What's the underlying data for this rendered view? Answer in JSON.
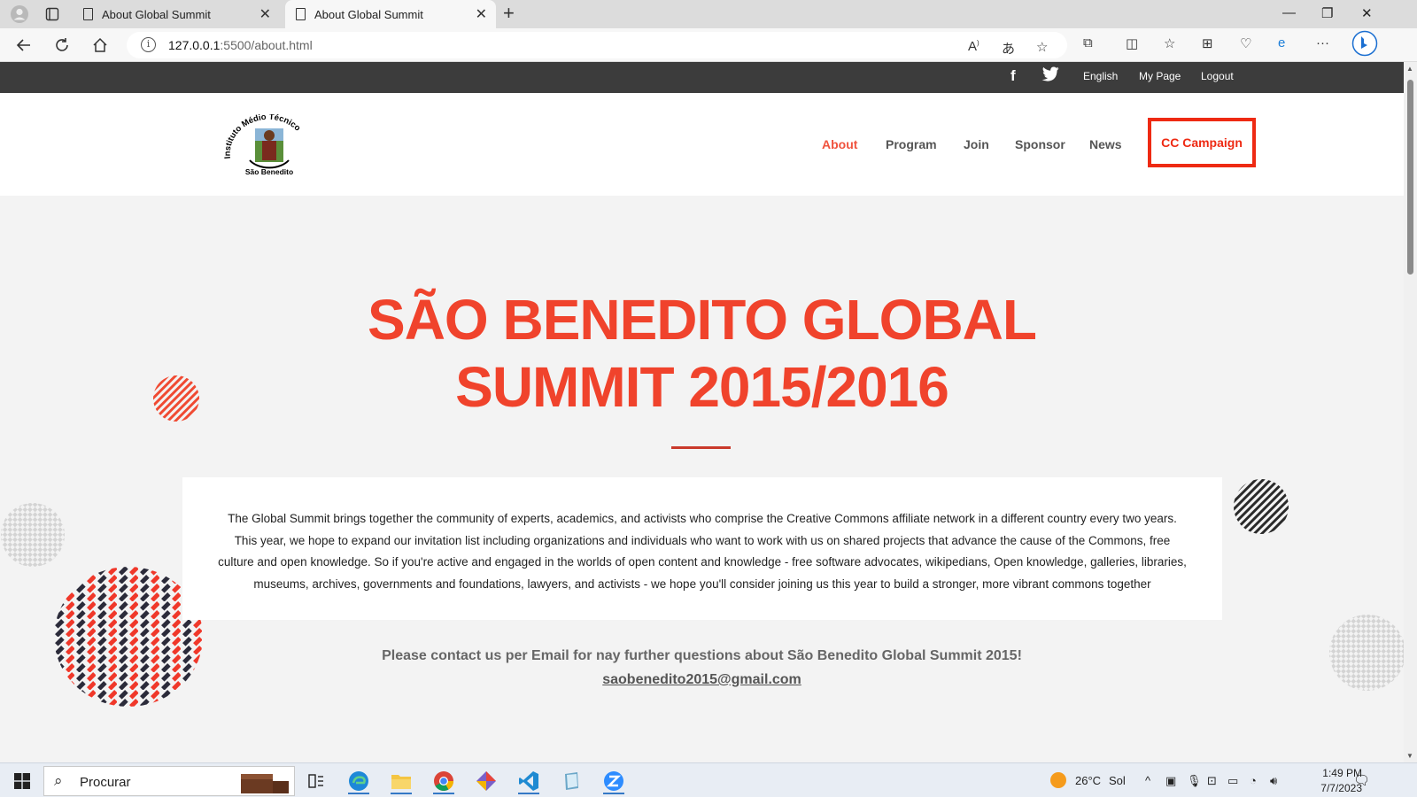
{
  "browser": {
    "tabs": [
      {
        "title": "About Global Summit",
        "active": false
      },
      {
        "title": "About Global Summit",
        "active": true
      }
    ],
    "url_host": "127.0.0.1",
    "url_rest": ":5500/about.html",
    "window_controls": [
      "—",
      "❐",
      "✕"
    ]
  },
  "site": {
    "topbar": {
      "social": [
        "facebook-icon",
        "twitter-icon"
      ],
      "language": "English",
      "my_page": "My Page",
      "logout": "Logout"
    },
    "logo": {
      "top_text": "Instituto Médio Técnico",
      "bottom_text": "São Benedito"
    },
    "menu": {
      "about": "About",
      "program": "Program",
      "join": "Join",
      "sponsor": "Sponsor",
      "news": "News",
      "campaign": "CC Campaign"
    },
    "hero": {
      "title_line1": "SÃO BENEDITO GLOBAL",
      "title_line2": "SUMMIT 2015/2016"
    },
    "about": {
      "line1": "The Global Summit brings together the community of experts, academics, and activists who comprise the Creative Commons affiliate network in a different country every two years.",
      "line2": "This year, we hope to expand our invitation list including organizations and individuals who want to work with us on shared projects that advance the cause of the Commons, free",
      "line3": "culture and open knowledge. So if you're active and engaged in the worlds of open content and knowledge - free software advocates, wikipedians, Open knowledge, galleries, libraries,",
      "line4": "museums, archives, governments and foundations, lawyers, and activists - we hope you'll consider joining us this year to build a stronger, more vibrant commons together"
    },
    "contact": {
      "text": "Please contact us per Email for nay further questions about São Benedito Global Summit 2015!",
      "email": "saobenedito2015@gmail.com"
    },
    "colors": {
      "accent": "#f0432c",
      "topbar": "#3c3c3c",
      "campaign_border": "#ee2a13"
    }
  },
  "taskbar": {
    "search_placeholder": "Procurar",
    "weather_temp": "26°C",
    "weather_text": "Sol",
    "time": "1:49 PM",
    "date": "7/7/2023"
  }
}
